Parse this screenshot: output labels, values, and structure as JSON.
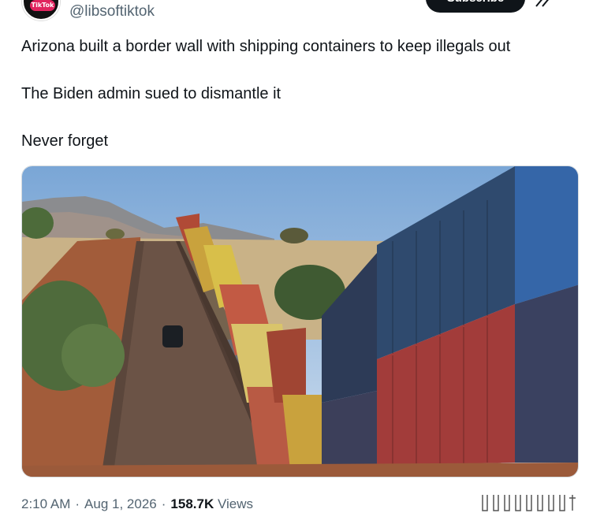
{
  "author": {
    "handle": "@libsoftiktok",
    "avatar_badge": "TikTok"
  },
  "header": {
    "subscribe_label": "Subscribe",
    "grok_icon": "grok-icon"
  },
  "tweet": {
    "lines": [
      "Arizona built a border wall with shipping containers to keep illegals out",
      "The Biden admin sued to dismantle it",
      "Never forget"
    ]
  },
  "media": {
    "description_icon": "photo"
  },
  "meta": {
    "time": "2:10 AM",
    "separator": "·",
    "date": "Aug 1, 2026",
    "views_count": "158.7K",
    "views_label": "Views"
  },
  "colors": {
    "text": "#0f1419",
    "secondary": "#536471",
    "subscribe_bg": "#0f1419"
  }
}
